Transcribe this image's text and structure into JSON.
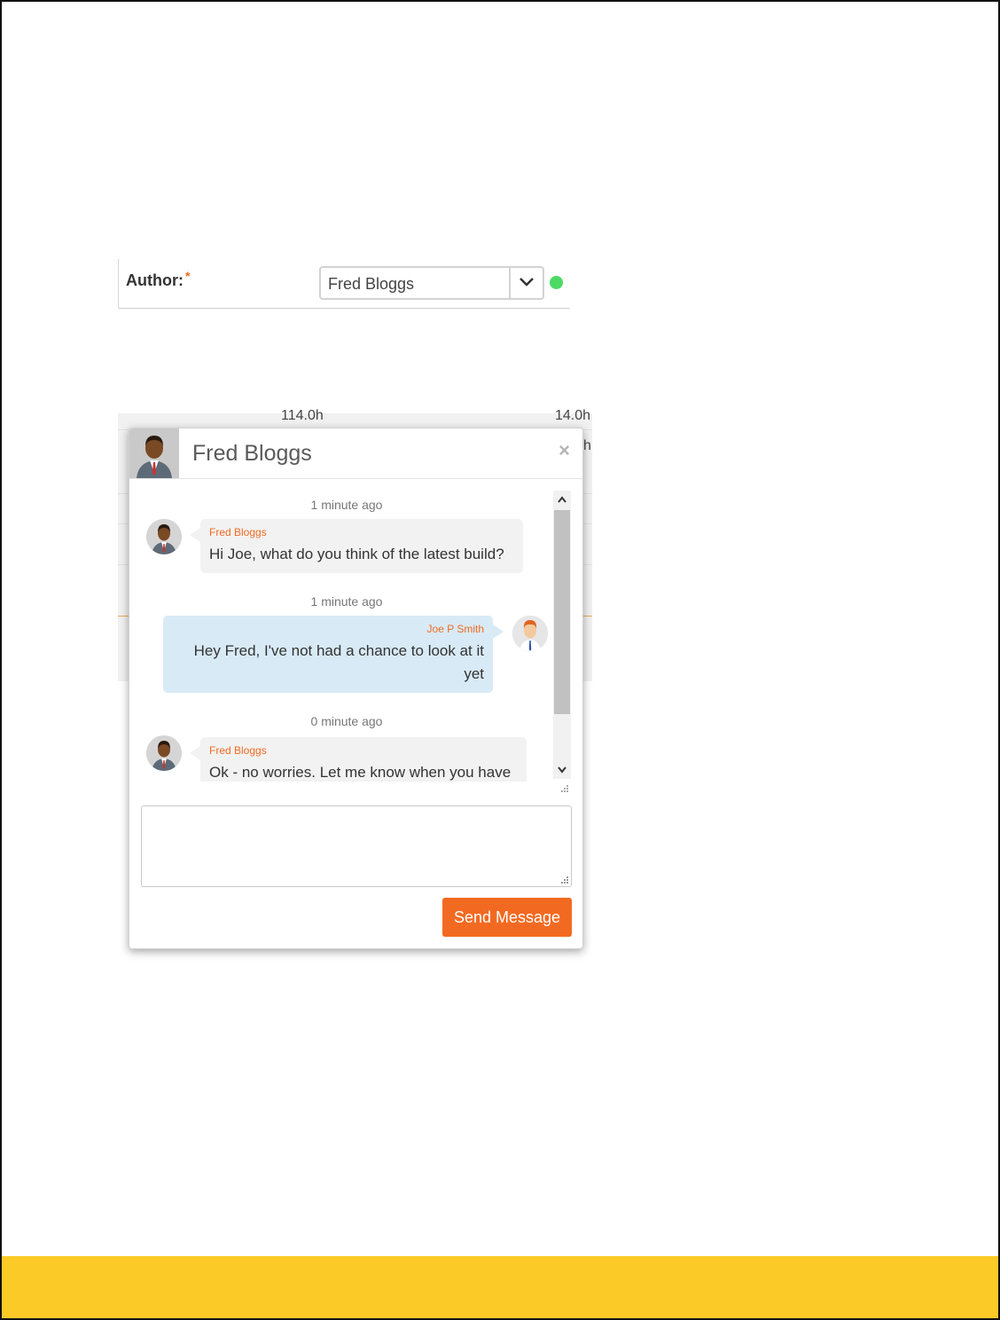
{
  "author_field": {
    "label": "Author:",
    "required_mark": "*",
    "selected_value": "Fred Bloggs",
    "status_color": "#4cd964"
  },
  "background": {
    "fragment_left": "114.0h",
    "fragment_right": "14.0h",
    "fragment_edge": "h"
  },
  "chat": {
    "title": "Fred Bloggs",
    "close_icon": "×",
    "messages": [
      {
        "timestamp": "1 minute ago",
        "sender": "Fred Bloggs",
        "text": "Hi Joe, what do you think of the latest build?",
        "direction": "in"
      },
      {
        "timestamp": "1 minute ago",
        "sender": "Joe P Smith",
        "text": "Hey Fred, I've not had a chance to look at it yet",
        "direction": "out"
      },
      {
        "timestamp": "0 minute ago",
        "sender": "Fred Bloggs",
        "text": "Ok - no worries. Let me know when you have",
        "direction": "in"
      }
    ],
    "input_value": "",
    "send_label": "Send Message"
  },
  "colors": {
    "accent": "#f26a21",
    "outgoing_bubble": "#d8eaf6",
    "incoming_bubble": "#f2f2f2",
    "footer_band": "#fbca26"
  }
}
